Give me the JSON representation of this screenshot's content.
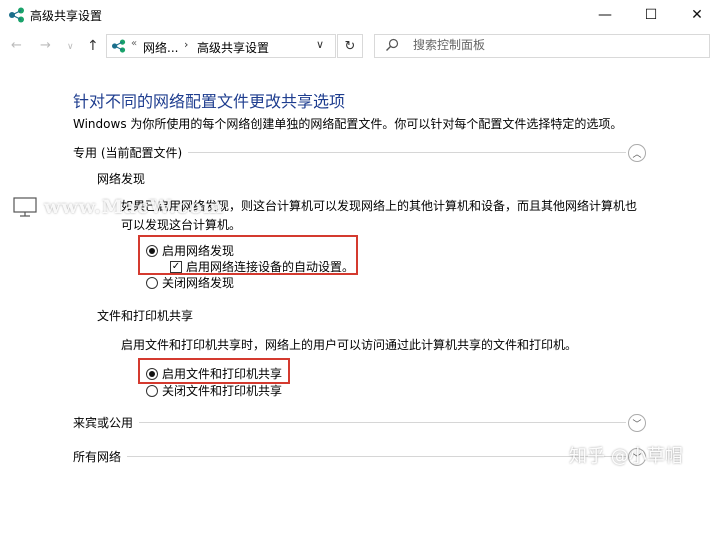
{
  "window": {
    "title": "高级共享设置",
    "minimize_symbol": "—",
    "maximize_symbol": "☐",
    "close_symbol": "✕"
  },
  "nav": {
    "back_symbol": "←",
    "forward_symbol": "→",
    "recent_symbol": "∨",
    "up_symbol": "↑",
    "crumb_overflow": "«",
    "crumb_sep": "›",
    "crumbs": [
      "网络...",
      "高级共享设置"
    ],
    "dropdown_symbol": "∨",
    "refresh_symbol": "↻",
    "search_placeholder": "搜索控制面板"
  },
  "page": {
    "heading": "针对不同的网络配置文件更改共享选项",
    "description": "Windows 为你所使用的每个网络创建单独的网络配置文件。你可以针对每个配置文件选择特定的选项。"
  },
  "sections": {
    "private": {
      "title": "专用 (当前配置文件)",
      "expander_symbol": "︿",
      "discovery": {
        "title": "网络发现",
        "paragraph": "如果已启用网络发现，则这台计算机可以发现网络上的其他计算机和设备，而且其他网络计算机也可以发现这台计算机。",
        "option_on": "启用网络发现",
        "auto_setup": "启用网络连接设备的自动设置。",
        "auto_setup_check": "✓",
        "option_off": "关闭网络发现"
      },
      "file_print": {
        "title": "文件和打印机共享",
        "paragraph": "启用文件和打印机共享时，网络上的用户可以访问通过此计算机共享的文件和打印机。",
        "option_on": "启用文件和打印机共享",
        "option_off": "关闭文件和打印机共享"
      }
    },
    "guest": {
      "title": "来宾或公用",
      "expander_symbol": "﹀"
    },
    "all": {
      "title": "所有网络",
      "expander_symbol": "﹀"
    }
  },
  "overlays": {
    "watermark": "www.MacW.com",
    "credit": "知乎 @小草帽"
  },
  "colors": {
    "heading": "#1e3d8f",
    "highlight": "#d43a2f",
    "network_icon_green": "#1aa36a",
    "network_icon_teal": "#1b6f8c"
  }
}
